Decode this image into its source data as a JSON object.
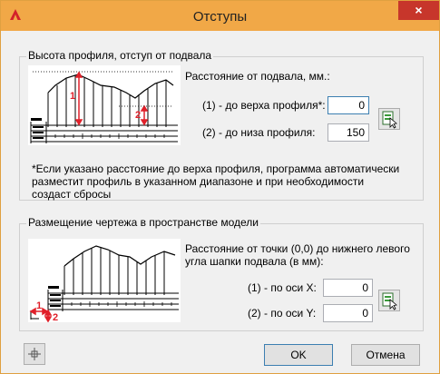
{
  "window": {
    "title": "Отступы",
    "close": "×"
  },
  "group1": {
    "legend": "Высота профиля, отступ от подвала",
    "distance_label": "Расстояние от подвала, мм.:",
    "top_label": "(1) - до верха профиля*:",
    "top_value": "0",
    "bottom_label": "(2) - до низа профиля:",
    "bottom_value": "150",
    "note_lines": [
      "*Если указано расстояние до верха профиля, программа автоматически",
      "разместит профиль в указанном диапазоне и при необходимости",
      "создаст сбросы"
    ],
    "marker_1": "1",
    "marker_2": "2"
  },
  "group2": {
    "legend": "Размещение чертежа в пространстве модели",
    "distance_lines": [
      "Расстояние от точки (0,0) до нижнего левого",
      "угла шапки подвала (в мм):"
    ],
    "x_label": "(1) - по оси X:",
    "x_value": "0",
    "y_label": "(2) - по оси Y:",
    "y_value": "0",
    "marker_1": "1",
    "marker_2": "2"
  },
  "footer": {
    "ok": "OK",
    "cancel": "Отмена"
  },
  "colors": {
    "title_bg": "#f1a847",
    "close_bg": "#c7362b",
    "marker": "#e0202a"
  },
  "icons": {
    "app": "autocad-logo-icon",
    "pick": "pick-point-icon",
    "snap": "crosshair-icon"
  }
}
